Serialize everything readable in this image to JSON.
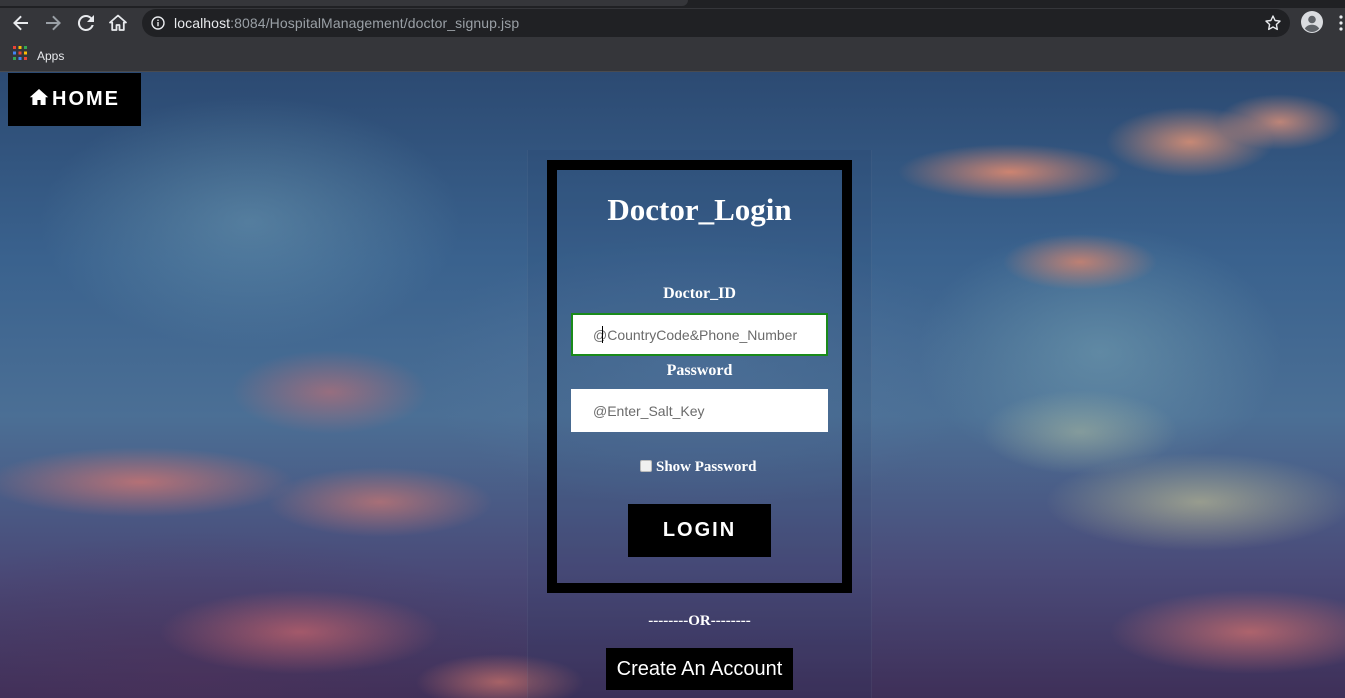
{
  "browser": {
    "url_host": "localhost",
    "url_rest": ":8084/HospitalManagement/doctor_signup.jsp",
    "bookmarks": {
      "apps_label": "Apps"
    },
    "icons": {
      "back": "back-arrow-icon",
      "forward": "forward-arrow-icon",
      "reload": "reload-icon",
      "home": "home-icon",
      "info": "info-icon",
      "bookmark_star": "star-icon",
      "profile": "profile-icon",
      "menu": "menu-dots-icon",
      "apps": "apps-grid-icon"
    }
  },
  "page": {
    "home_button": {
      "label": "HOME",
      "icon": "home-icon"
    },
    "login": {
      "title": "Doctor_Login",
      "doctor_id_label": "Doctor_ID",
      "doctor_id_placeholder": "@CountryCode&Phone_Number",
      "doctor_id_value": "",
      "password_label": "Password",
      "password_placeholder": "@Enter_Salt_Key",
      "password_value": "",
      "show_password_label": "Show Password",
      "show_password_checked": false,
      "login_button": "LOGIN"
    },
    "separator": "--------OR--------",
    "create_account": "Create An Account"
  },
  "colors": {
    "focus_border": "#1a8a1a",
    "button_bg": "#000000",
    "text_light": "#ffffff",
    "chrome_bg": "#35363a"
  }
}
